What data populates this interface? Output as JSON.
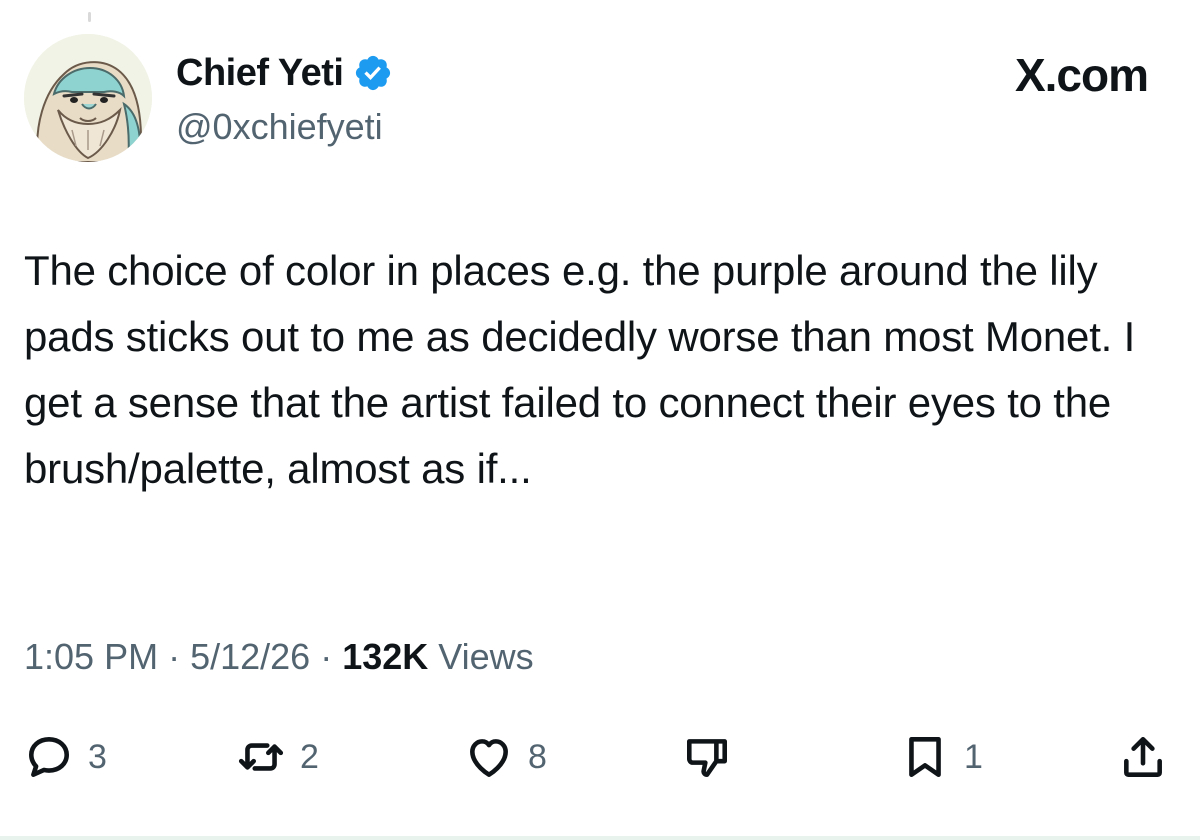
{
  "author": {
    "display_name": "Chief Yeti",
    "handle": "@0xchiefyeti",
    "verified": true,
    "avatar_description": "cartoon yeti avatar"
  },
  "brand": "X.com",
  "tweet": {
    "text": "The choice of color in places e.g. the purple around the lily pads sticks out to me as decidedly worse than most Monet. I get a sense that the artist failed to connect their eyes to the brush/palette, almost as if...",
    "time": "1:05 PM",
    "separator": "·",
    "date": "5/12/26",
    "views_count": "132K",
    "views_label": "Views"
  },
  "actions": {
    "replies": "3",
    "reposts": "2",
    "likes": "8",
    "bookmarks": "1"
  },
  "colors": {
    "text_primary": "#0f1419",
    "text_secondary": "#536471",
    "verified_blue": "#1d9bf0"
  }
}
